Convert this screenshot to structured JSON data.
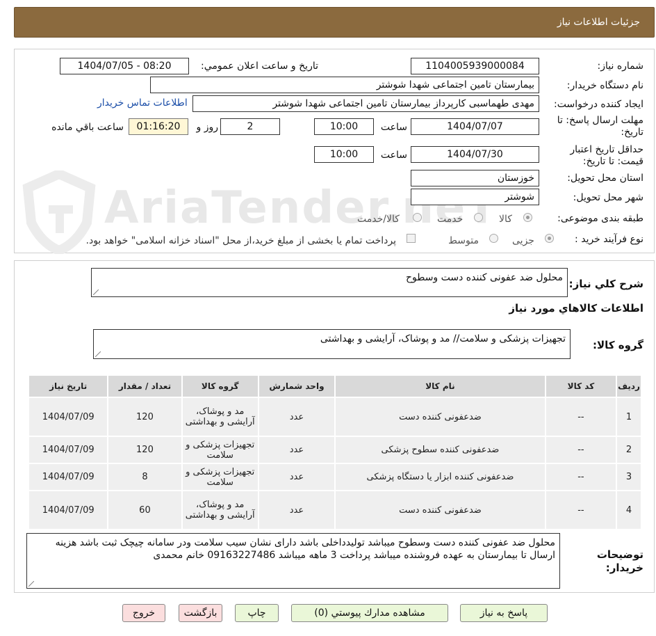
{
  "header": {
    "title": "جزئیات اطلاعات نیاز"
  },
  "form": {
    "need_number_label": "شماره نیاز:",
    "need_number": "1104005939000084",
    "announce_label": "تاریخ و ساعت اعلان عمومي:",
    "announce_value": "1404/07/05 - 08:20",
    "buyer_org_label": "نام دستگاه خریدار:",
    "buyer_org": "بیمارستان تامین اجتماعی شهدا شوشتر",
    "creator_label": "ایجاد کننده درخواست:",
    "creator": "مهدی طهماسبی کارپرداز بیمارستان تامین اجتماعی شهدا شوشتر",
    "contact_link": "اطلاعات تماس خریدار",
    "deadline_label": "مهلت ارسال پاسخ: تا تاریخ:",
    "deadline_date": "1404/07/07",
    "time_label": "ساعت",
    "deadline_time": "10:00",
    "days": "2",
    "days_label": "روز و",
    "remaining": "01:16:20",
    "remaining_label": "ساعت باقي مانده",
    "validity_label": "حداقل تاریخ اعتبار قیمت: تا تاریخ:",
    "validity_date": "1404/07/30",
    "validity_time": "10:00",
    "province_label": "استان محل تحویل:",
    "province": "خوزستان",
    "city_label": "شهر محل تحویل:",
    "city": "شوشتر",
    "category_label": "طبقه بندی موضوعی:",
    "category_options": [
      "کالا",
      "خدمت",
      "کالا/خدمت"
    ],
    "process_label": "نوع فرآیند خرید :",
    "process_options": [
      "جزیی",
      "متوسط"
    ],
    "payment_note": "پرداخت تمام یا بخشی از مبلغ خرید،از محل \"اسناد خزانه اسلامی\" خواهد بود."
  },
  "watermark": "AriaTender.neT",
  "summary": {
    "label": "شرح کلي نیاز:",
    "value": "محلول ضد عفونی کننده دست وسطوح"
  },
  "goods_info": {
    "title": "اطلاعات کالاهاي مورد نیاز",
    "group_label": "گروه کالا:",
    "group_value": "تجهیزات پزشکی و سلامت// مد و پوشاک، آرایشی و بهداشتی"
  },
  "table": {
    "headers": [
      "ردیف",
      "کد کالا",
      "نام کالا",
      "واحد شمارش",
      "گروه کالا",
      "تعداد / مقدار",
      "تاریخ نیاز"
    ],
    "rows": [
      [
        "1",
        "--",
        "ضدعفونی کننده دست",
        "عدد",
        "مد و پوشاک، آرایشی و بهداشتی",
        "120",
        "1404/07/09"
      ],
      [
        "2",
        "--",
        "ضدعفونی کننده سطوح پزشکی",
        "عدد",
        "تجهیزات پزشکی و سلامت",
        "120",
        "1404/07/09"
      ],
      [
        "3",
        "--",
        "ضدعفونی کننده ابزار یا دستگاه پزشکی",
        "عدد",
        "تجهیزات پزشکی و سلامت",
        "8",
        "1404/07/09"
      ],
      [
        "4",
        "--",
        "ضدعفونی کننده دست",
        "عدد",
        "مد و پوشاک، آرایشی و بهداشتی",
        "60",
        "1404/07/09"
      ]
    ]
  },
  "buyer_notes": {
    "label": "توضیحات خریدار:",
    "value": "محلول ضد عفونی کننده دست وسطوح میباشد تولیدداخلی باشد دارای نشان سیب سلامت ودر سامانه چیچک ثبت باشد هزینه ارسال تا بیمارستان به عهده فروشنده میباشد پرداخت 3 ماهه میباشد 09163227486 خانم محمدی"
  },
  "buttons": {
    "reply": "پاسخ به نیاز",
    "attachments": "مشاهده مدارك پیوستي (0)",
    "print": "چاپ",
    "back": "بازگشت",
    "exit": "خروج"
  }
}
